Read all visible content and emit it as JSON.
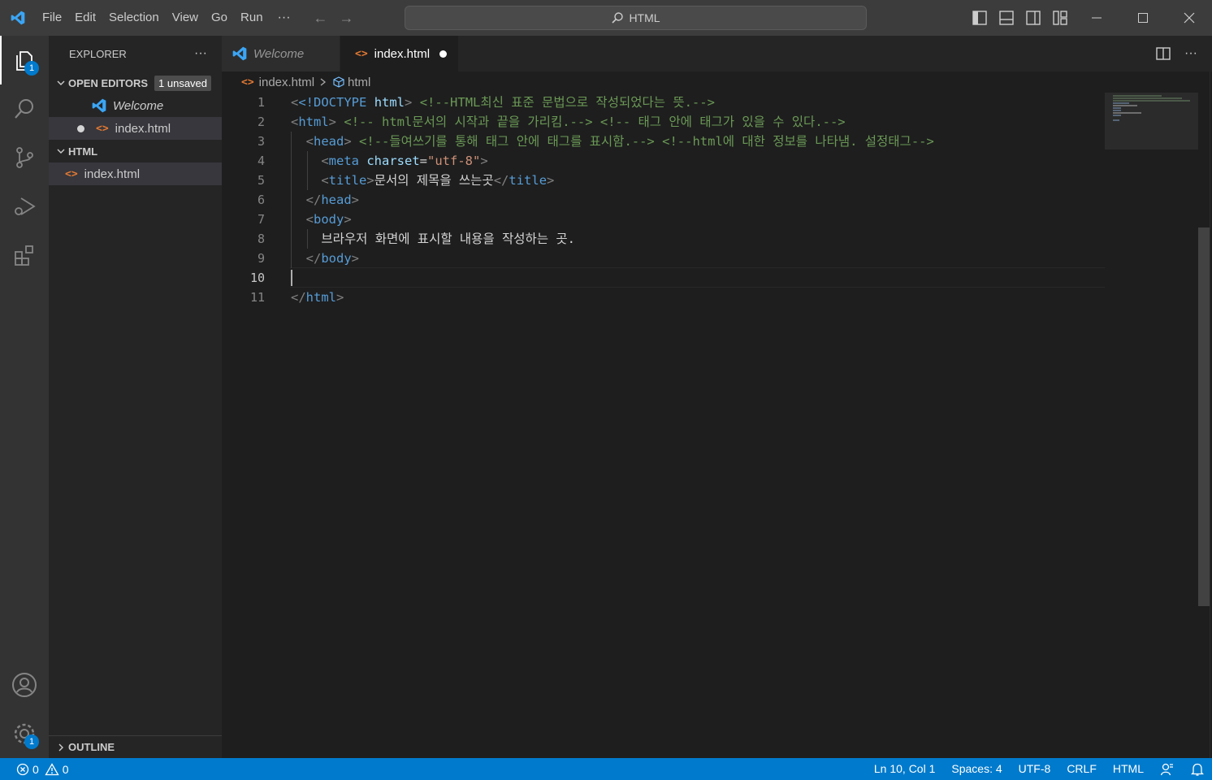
{
  "menu": {
    "file": "File",
    "edit": "Edit",
    "selection": "Selection",
    "view": "View",
    "go": "Go",
    "run": "Run",
    "more": "···"
  },
  "command_center": {
    "label": "HTML"
  },
  "activity": {
    "explorer_badge": "1",
    "settings_badge": "1"
  },
  "sidebar": {
    "title": "EXPLORER",
    "more": "···",
    "open_editors": {
      "label": "OPEN EDITORS",
      "unsaved": "1 unsaved",
      "items": [
        "Welcome",
        "index.html"
      ]
    },
    "folder": {
      "label": "HTML",
      "files": [
        "index.html"
      ]
    },
    "outline": "OUTLINE"
  },
  "tabs": [
    {
      "label": "Welcome"
    },
    {
      "label": "index.html",
      "dirty": true
    }
  ],
  "breadcrumb": {
    "file": "index.html",
    "symbol": "html"
  },
  "editor": {
    "line_numbers": [
      "1",
      "2",
      "3",
      "4",
      "5",
      "6",
      "7",
      "8",
      "9",
      "10",
      "11"
    ],
    "current_line": "10",
    "tokens": {
      "l1_doctype": "<!DOCTYPE",
      "l1_html": "html",
      "l1_cmt": "<!--HTML최신 표준 문법으로 작성되었다는 뜻.-->",
      "l2_tag": "html",
      "l2_cmt1": "<!-- html문서의 시작과 끝을 가리킴.-->",
      "l2_cmt2": "<!-- 태그 안에 태그가 있을 수 있다.-->",
      "l3_tag": "head",
      "l3_cmt1": "<!--들여쓰기를 통해 태그 안에 태그를 표시함.-->",
      "l3_cmt2": "<!--html에 대한 정보를 나타냄. 설정태그-->",
      "l4_tag": "meta",
      "l4_attr": "charset",
      "l4_val": "\"utf-8\"",
      "l5_tag": "title",
      "l5_text": "문서의 제목을 쓰는곳",
      "l6_tag": "head",
      "l7_tag": "body",
      "l8_text": "브라우저 화면에 표시할 내용을 작성하는 곳.",
      "l9_tag": "body",
      "l11_tag": "html"
    }
  },
  "status": {
    "errors": "0",
    "warnings": "0",
    "position": "Ln 10, Col 1",
    "spaces": "Spaces: 4",
    "encoding": "UTF-8",
    "eol": "CRLF",
    "language": "HTML"
  },
  "colors": {
    "accent": "#007acc",
    "tag": "#569cd6",
    "attr": "#9cdcfe",
    "string": "#ce9178",
    "comment": "#6a9955",
    "html_icon": "#e37933",
    "vscode_blue": "#3ba5f5"
  }
}
